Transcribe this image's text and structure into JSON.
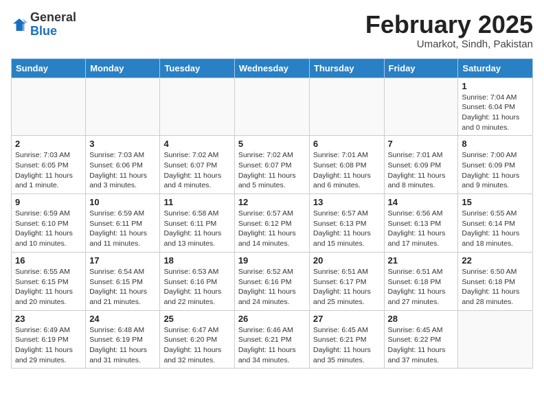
{
  "header": {
    "logo_general": "General",
    "logo_blue": "Blue",
    "month_title": "February 2025",
    "location": "Umarkot, Sindh, Pakistan"
  },
  "weekdays": [
    "Sunday",
    "Monday",
    "Tuesday",
    "Wednesday",
    "Thursday",
    "Friday",
    "Saturday"
  ],
  "weeks": [
    [
      {
        "day": "",
        "info": ""
      },
      {
        "day": "",
        "info": ""
      },
      {
        "day": "",
        "info": ""
      },
      {
        "day": "",
        "info": ""
      },
      {
        "day": "",
        "info": ""
      },
      {
        "day": "",
        "info": ""
      },
      {
        "day": "1",
        "info": "Sunrise: 7:04 AM\nSunset: 6:04 PM\nDaylight: 11 hours\nand 0 minutes."
      }
    ],
    [
      {
        "day": "2",
        "info": "Sunrise: 7:03 AM\nSunset: 6:05 PM\nDaylight: 11 hours\nand 1 minute."
      },
      {
        "day": "3",
        "info": "Sunrise: 7:03 AM\nSunset: 6:06 PM\nDaylight: 11 hours\nand 3 minutes."
      },
      {
        "day": "4",
        "info": "Sunrise: 7:02 AM\nSunset: 6:07 PM\nDaylight: 11 hours\nand 4 minutes."
      },
      {
        "day": "5",
        "info": "Sunrise: 7:02 AM\nSunset: 6:07 PM\nDaylight: 11 hours\nand 5 minutes."
      },
      {
        "day": "6",
        "info": "Sunrise: 7:01 AM\nSunset: 6:08 PM\nDaylight: 11 hours\nand 6 minutes."
      },
      {
        "day": "7",
        "info": "Sunrise: 7:01 AM\nSunset: 6:09 PM\nDaylight: 11 hours\nand 8 minutes."
      },
      {
        "day": "8",
        "info": "Sunrise: 7:00 AM\nSunset: 6:09 PM\nDaylight: 11 hours\nand 9 minutes."
      }
    ],
    [
      {
        "day": "9",
        "info": "Sunrise: 6:59 AM\nSunset: 6:10 PM\nDaylight: 11 hours\nand 10 minutes."
      },
      {
        "day": "10",
        "info": "Sunrise: 6:59 AM\nSunset: 6:11 PM\nDaylight: 11 hours\nand 11 minutes."
      },
      {
        "day": "11",
        "info": "Sunrise: 6:58 AM\nSunset: 6:11 PM\nDaylight: 11 hours\nand 13 minutes."
      },
      {
        "day": "12",
        "info": "Sunrise: 6:57 AM\nSunset: 6:12 PM\nDaylight: 11 hours\nand 14 minutes."
      },
      {
        "day": "13",
        "info": "Sunrise: 6:57 AM\nSunset: 6:13 PM\nDaylight: 11 hours\nand 15 minutes."
      },
      {
        "day": "14",
        "info": "Sunrise: 6:56 AM\nSunset: 6:13 PM\nDaylight: 11 hours\nand 17 minutes."
      },
      {
        "day": "15",
        "info": "Sunrise: 6:55 AM\nSunset: 6:14 PM\nDaylight: 11 hours\nand 18 minutes."
      }
    ],
    [
      {
        "day": "16",
        "info": "Sunrise: 6:55 AM\nSunset: 6:15 PM\nDaylight: 11 hours\nand 20 minutes."
      },
      {
        "day": "17",
        "info": "Sunrise: 6:54 AM\nSunset: 6:15 PM\nDaylight: 11 hours\nand 21 minutes."
      },
      {
        "day": "18",
        "info": "Sunrise: 6:53 AM\nSunset: 6:16 PM\nDaylight: 11 hours\nand 22 minutes."
      },
      {
        "day": "19",
        "info": "Sunrise: 6:52 AM\nSunset: 6:16 PM\nDaylight: 11 hours\nand 24 minutes."
      },
      {
        "day": "20",
        "info": "Sunrise: 6:51 AM\nSunset: 6:17 PM\nDaylight: 11 hours\nand 25 minutes."
      },
      {
        "day": "21",
        "info": "Sunrise: 6:51 AM\nSunset: 6:18 PM\nDaylight: 11 hours\nand 27 minutes."
      },
      {
        "day": "22",
        "info": "Sunrise: 6:50 AM\nSunset: 6:18 PM\nDaylight: 11 hours\nand 28 minutes."
      }
    ],
    [
      {
        "day": "23",
        "info": "Sunrise: 6:49 AM\nSunset: 6:19 PM\nDaylight: 11 hours\nand 29 minutes."
      },
      {
        "day": "24",
        "info": "Sunrise: 6:48 AM\nSunset: 6:19 PM\nDaylight: 11 hours\nand 31 minutes."
      },
      {
        "day": "25",
        "info": "Sunrise: 6:47 AM\nSunset: 6:20 PM\nDaylight: 11 hours\nand 32 minutes."
      },
      {
        "day": "26",
        "info": "Sunrise: 6:46 AM\nSunset: 6:21 PM\nDaylight: 11 hours\nand 34 minutes."
      },
      {
        "day": "27",
        "info": "Sunrise: 6:45 AM\nSunset: 6:21 PM\nDaylight: 11 hours\nand 35 minutes."
      },
      {
        "day": "28",
        "info": "Sunrise: 6:45 AM\nSunset: 6:22 PM\nDaylight: 11 hours\nand 37 minutes."
      },
      {
        "day": "",
        "info": ""
      }
    ]
  ]
}
